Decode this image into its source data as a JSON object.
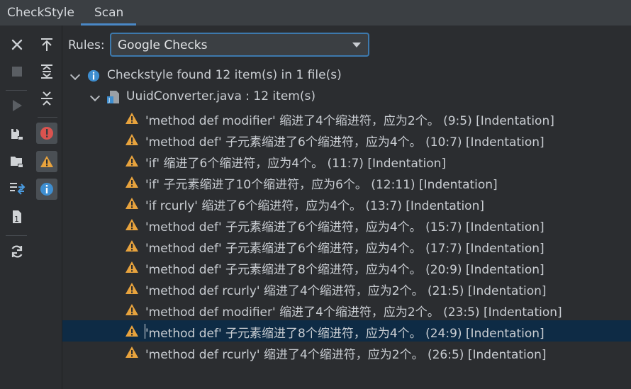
{
  "tabs": [
    "CheckStyle",
    "Scan"
  ],
  "rules": {
    "label": "Rules:",
    "selected": "Google Checks"
  },
  "summary": "Checkstyle found 12 item(s) in 1 file(s)",
  "file": "UuidConverter.java : 12 item(s)",
  "items": [
    "'method def modifier' 缩进了4个缩进符，应为2个。 (9:5) [Indentation]",
    "'method def' 子元素缩进了6个缩进符，应为4个。 (10:7) [Indentation]",
    "'if' 缩进了6个缩进符，应为4个。 (11:7) [Indentation]",
    "'if' 子元素缩进了10个缩进符，应为6个。 (12:11) [Indentation]",
    "'if rcurly' 缩进了6个缩进符，应为4个。 (13:7) [Indentation]",
    "'method def' 子元素缩进了6个缩进符，应为4个。 (15:7) [Indentation]",
    "'method def' 子元素缩进了6个缩进符，应为4个。 (17:7) [Indentation]",
    "'method def' 子元素缩进了8个缩进符，应为4个。 (20:9) [Indentation]",
    "'method def rcurly' 缩进了4个缩进符，应为2个。 (21:5) [Indentation]",
    "'method def modifier' 缩进了4个缩进符，应为2个。 (23:5) [Indentation]",
    "'method def' 子元素缩进了8个缩进符，应为4个。 (24:9) [Indentation]",
    "'method def rcurly' 缩进了4个缩进符，应为2个。 (26:5) [Indentation]"
  ],
  "selected_index": 10,
  "colors": {
    "accent": "#4a88c7",
    "warning": "#e8a33d",
    "error": "#d9534f",
    "info": "#3e8ed0",
    "selection": "#0e2b45"
  },
  "icons": {
    "toolbar_left": [
      "close-icon",
      "stop-icon",
      "run-icon",
      "check-module-icon",
      "check-project-icon",
      "check-changes-icon",
      "check-file-icon",
      "rescan-icon"
    ],
    "toolbar_right": [
      "scroll-to-top-icon",
      "expand-all-icon",
      "collapse-all-icon",
      "filter-error-icon",
      "filter-warning-icon",
      "filter-info-icon"
    ]
  }
}
